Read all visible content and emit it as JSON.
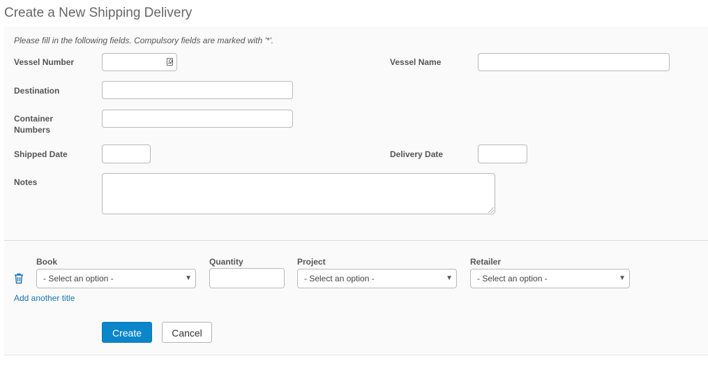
{
  "page": {
    "title": "Create a New Shipping Delivery",
    "instructions": "Please fill in the following fields. Compulsory fields are marked with '*'."
  },
  "fields": {
    "vessel_number": {
      "label": "Vessel Number",
      "value": ""
    },
    "vessel_name": {
      "label": "Vessel Name",
      "value": ""
    },
    "destination": {
      "label": "Destination",
      "value": ""
    },
    "container_numbers": {
      "label_line1": "Container",
      "label_line2": "Numbers",
      "value": ""
    },
    "shipped_date": {
      "label": "Shipped Date",
      "value": ""
    },
    "delivery_date": {
      "label": "Delivery Date",
      "value": ""
    },
    "notes": {
      "label": "Notes",
      "value": ""
    }
  },
  "line_items": {
    "headers": {
      "book": "Book",
      "quantity": "Quantity",
      "project": "Project",
      "retailer": "Retailer"
    },
    "row": {
      "book": "- Select an option -",
      "quantity": "",
      "project": "- Select an option -",
      "retailer": "- Select an option -"
    },
    "add_link": "Add another title"
  },
  "icons": {
    "vessel_number": "contact-card-icon",
    "remove_row": "trash-icon"
  },
  "actions": {
    "create": "Create",
    "cancel": "Cancel"
  },
  "colors": {
    "primary": "#0a86c9",
    "link": "#1a73b5",
    "panel_bg": "#fafafa"
  }
}
